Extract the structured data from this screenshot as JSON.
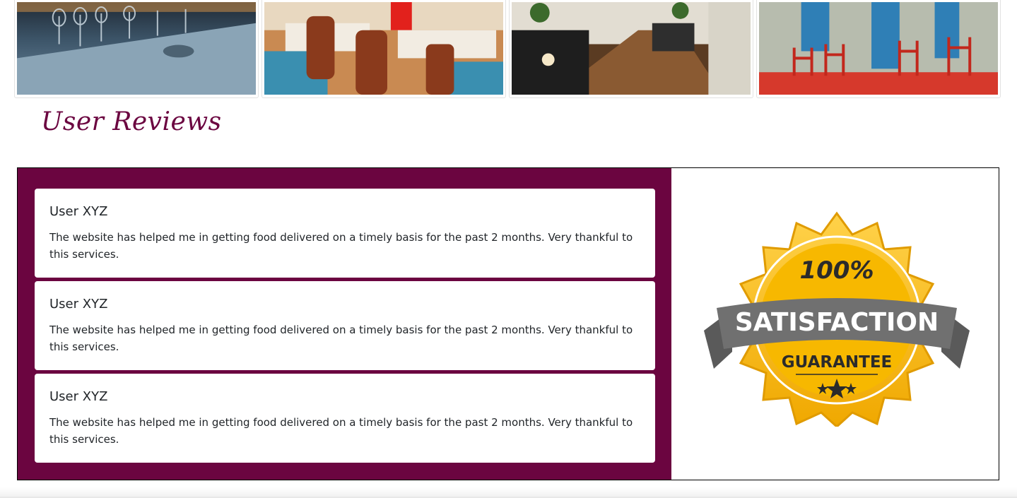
{
  "gallery": {
    "images": [
      {
        "name": "table-setting-photo"
      },
      {
        "name": "restaurant-interior-photo"
      },
      {
        "name": "cafe-interior-photo"
      },
      {
        "name": "street-cafe-photo"
      }
    ]
  },
  "section": {
    "title": "User Reviews"
  },
  "reviews": [
    {
      "user": "User XYZ",
      "text": "The website has helped me in getting food delivered on a timely basis for the past 2 months. Very thankful to this services."
    },
    {
      "user": "User XYZ",
      "text": "The website has helped me in getting food delivered on a timely basis for the past 2 months. Very thankful to this services."
    },
    {
      "user": "User XYZ",
      "text": "The website has helped me in getting food delivered on a timely basis for the past 2 months. Very thankful to this services."
    }
  ],
  "badge": {
    "percent": "100%",
    "ribbon": "SATISFACTION",
    "guarantee": "GUARANTEE"
  },
  "colors": {
    "accent": "#6b0540",
    "gold": "#f5b800",
    "ribbon": "#6d6d6d"
  }
}
